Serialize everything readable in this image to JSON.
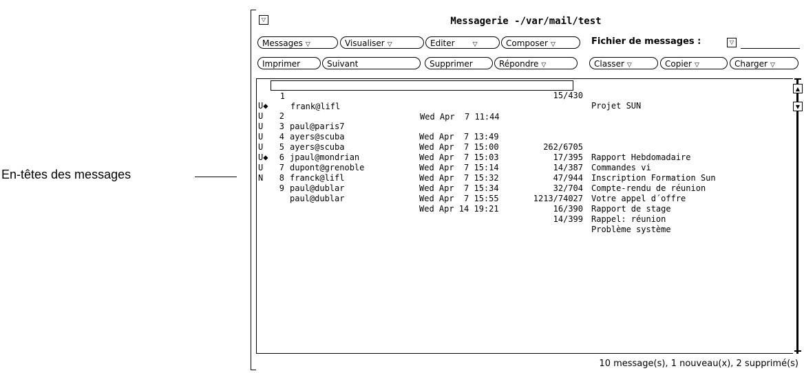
{
  "callout": {
    "label": "En-têtes des messages"
  },
  "window": {
    "title": "Messagerie  -/var/mail/test",
    "menu_glyph": "▽"
  },
  "toolbar1": {
    "messages": "Messages",
    "visualiser": "Visualiser",
    "editer": "Editer",
    "composer": "Composer",
    "fichier_label": "Fichier de messages :",
    "menu_glyph": "▽"
  },
  "toolbar2": {
    "imprimer": "Imprimer",
    "suivant": "Suivant",
    "supprimer": "Supprimer",
    "repondre": "Répondre",
    "classer": "Classer",
    "copier": "Copier",
    "charger": "Charger",
    "menu_glyph": "▽"
  },
  "messages": [
    {
      "flag": "",
      "num": "1",
      "from": "frank@lifl",
      "date": "Wed Apr  7 11:44",
      "size": "15/430",
      "subject": "Projet SUN"
    },
    {
      "flag": "U◆",
      "num": "2",
      "from": "paul@paris7",
      "date": "Wed Apr  7 13:49",
      "size": "262/6705",
      "subject": "Rapport Hebdomadaire"
    },
    {
      "flag": "U",
      "num": "3",
      "from": "ayers@scuba",
      "date": "Wed Apr  7 15:00",
      "size": "17/395",
      "subject": "Commandes vi"
    },
    {
      "flag": "U",
      "num": "4",
      "from": "ayers@scuba",
      "date": "Wed Apr  7 15:03",
      "size": "14/387",
      "subject": "Inscription Formation Sun"
    },
    {
      "flag": "U",
      "num": "5",
      "from": "jpaul@mondrian",
      "date": "Wed Apr  7 15:14",
      "size": "47/944",
      "subject": "Compte-rendu de réunion"
    },
    {
      "flag": "U",
      "num": "6",
      "from": "dupont@grenoble",
      "date": "Wed Apr  7 15:32",
      "size": "32/704",
      "subject": "Votre appel d´offre"
    },
    {
      "flag": "U◆",
      "num": "7",
      "from": "franck@lifl",
      "date": "Wed Apr  7 15:34",
      "size": "1213/74027",
      "subject": "Rapport de stage"
    },
    {
      "flag": "U",
      "num": "8",
      "from": "paul@dublar",
      "date": "Wed Apr  7 15:55",
      "size": "16/390",
      "subject": "Rappel: réunion"
    },
    {
      "flag": "N",
      "num": "9",
      "from": "paul@dublar",
      "date": "Wed Apr 14 19:21",
      "size": "14/399",
      "subject": "Problème système"
    }
  ],
  "status": {
    "text": "10 message(s), 1 nouveau(x), 2 supprimé(s)"
  }
}
